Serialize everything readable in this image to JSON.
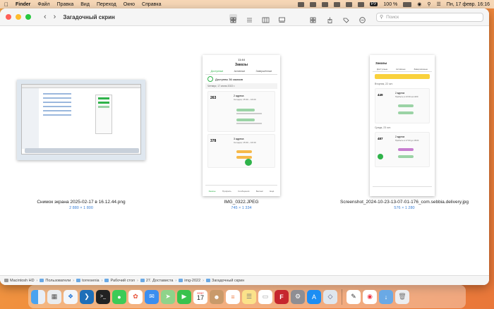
{
  "menubar": {
    "app": "Finder",
    "items": [
      "Файл",
      "Правка",
      "Вид",
      "Переход",
      "Окно",
      "Справка"
    ],
    "battery": "100 %",
    "lang": "РУ",
    "datetime": "Пн, 17 февр.  16:16"
  },
  "window": {
    "title": "Загадочный скрин",
    "search_placeholder": "Поиск"
  },
  "files": [
    {
      "name": "Снимок экрана 2025-02-17 в 16.12.44.png",
      "dims": "2 880 × 1 800"
    },
    {
      "name": "IMG_0322.JPEG",
      "dims": "745 × 1 334"
    },
    {
      "name": "Screenshot_2024-10-23-13-07-01-176_com.sebbia.delivery.jpg",
      "dims": "576 × 1 280"
    }
  ],
  "phone1": {
    "time": "11:44",
    "header": "Заказы",
    "tabs": [
      "Доступные",
      "Активные",
      "Завершённые"
    ],
    "banner": "Доступны 36 заказов",
    "date": "Четверг, 17 июня 2022 г.",
    "orders": [
      {
        "price": "263",
        "addr": "2 адреса",
        "time": "Сегодня, 15:30 – 16:00"
      },
      {
        "price": "378",
        "addr": "3 адреса",
        "time": "Сегодня, 15:30 – 16:30"
      }
    ],
    "nav": [
      "Заказы",
      "Профиль",
      "Сообщения",
      "Баланс",
      "Ещё"
    ]
  },
  "phone2": {
    "header": "Заказы",
    "tabs": [
      "Доступные",
      "Активные",
      "Завершённые"
    ],
    "date1": "Вторник, 22 окт.",
    "date2": "Среда, 23 окт.",
    "orders": [
      {
        "price": "449",
        "addr": "2 адреса",
        "time": "Прибыть в 13:30 на 1200"
      },
      {
        "price": "487",
        "addr": "2 адреса",
        "time": "Прибыть в 17:00 до 18:00"
      }
    ]
  },
  "pathbar": [
    {
      "label": "Macintosh HD",
      "type": "disk"
    },
    {
      "label": "Пользователи",
      "type": "folder"
    },
    {
      "label": "torresenia",
      "type": "folder"
    },
    {
      "label": "Рабочий стол",
      "type": "folder"
    },
    {
      "label": "27. Достависта",
      "type": "folder"
    },
    {
      "label": "img-2022",
      "type": "folder"
    },
    {
      "label": "Загадочный скрин",
      "type": "folder"
    }
  ],
  "dock": {
    "calendar_month": "ФЕВР.",
    "calendar_day": "17"
  },
  "colors": {
    "accent_green": "#2fb34a",
    "link_blue": "#3a7fd5",
    "wallpaper": "#ef8b3c"
  }
}
